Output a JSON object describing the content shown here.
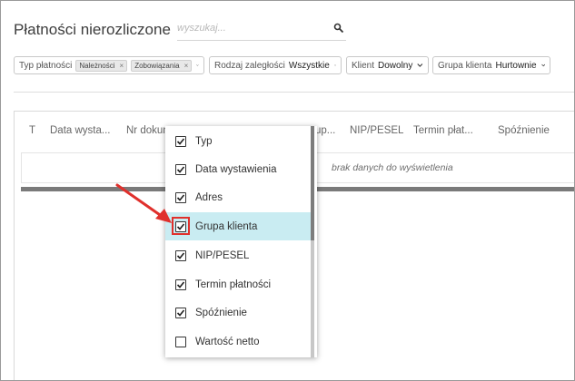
{
  "page": {
    "title": "Płatności nierozliczone",
    "search_placeholder": "wyszukaj..."
  },
  "filters": {
    "payment_type_label": "Typ płatności",
    "payment_type_tags": [
      "Należności",
      "Zobowiązania"
    ],
    "arrears_label": "Rodzaj zaległości",
    "arrears_value": "Wszystkie",
    "client_label": "Klient",
    "client_value": "Dowolny",
    "client_group_label": "Grupa klienta",
    "client_group_value": "Hurtownie"
  },
  "table": {
    "columns": [
      "T",
      "Data wysta...",
      "Nr dokum",
      "up...",
      "NIP/PESEL",
      "Termin płat...",
      "Spóźnienie"
    ],
    "empty_text": "brak danych do wyświetlenia"
  },
  "column_menu": {
    "items": [
      {
        "label": "Typ",
        "checked": true,
        "highlighted": false
      },
      {
        "label": "Data wystawienia",
        "checked": true,
        "highlighted": false
      },
      {
        "label": "Adres",
        "checked": true,
        "highlighted": false
      },
      {
        "label": "Grupa klienta",
        "checked": true,
        "highlighted": true
      },
      {
        "label": "NIP/PESEL",
        "checked": true,
        "highlighted": false
      },
      {
        "label": "Termin płatności",
        "checked": true,
        "highlighted": false
      },
      {
        "label": "Spóźnienie",
        "checked": true,
        "highlighted": false
      },
      {
        "label": "Wartość netto",
        "checked": false,
        "highlighted": false
      }
    ]
  },
  "colors": {
    "highlight": "#c9ecf2",
    "annotation_red": "#e0302c"
  }
}
